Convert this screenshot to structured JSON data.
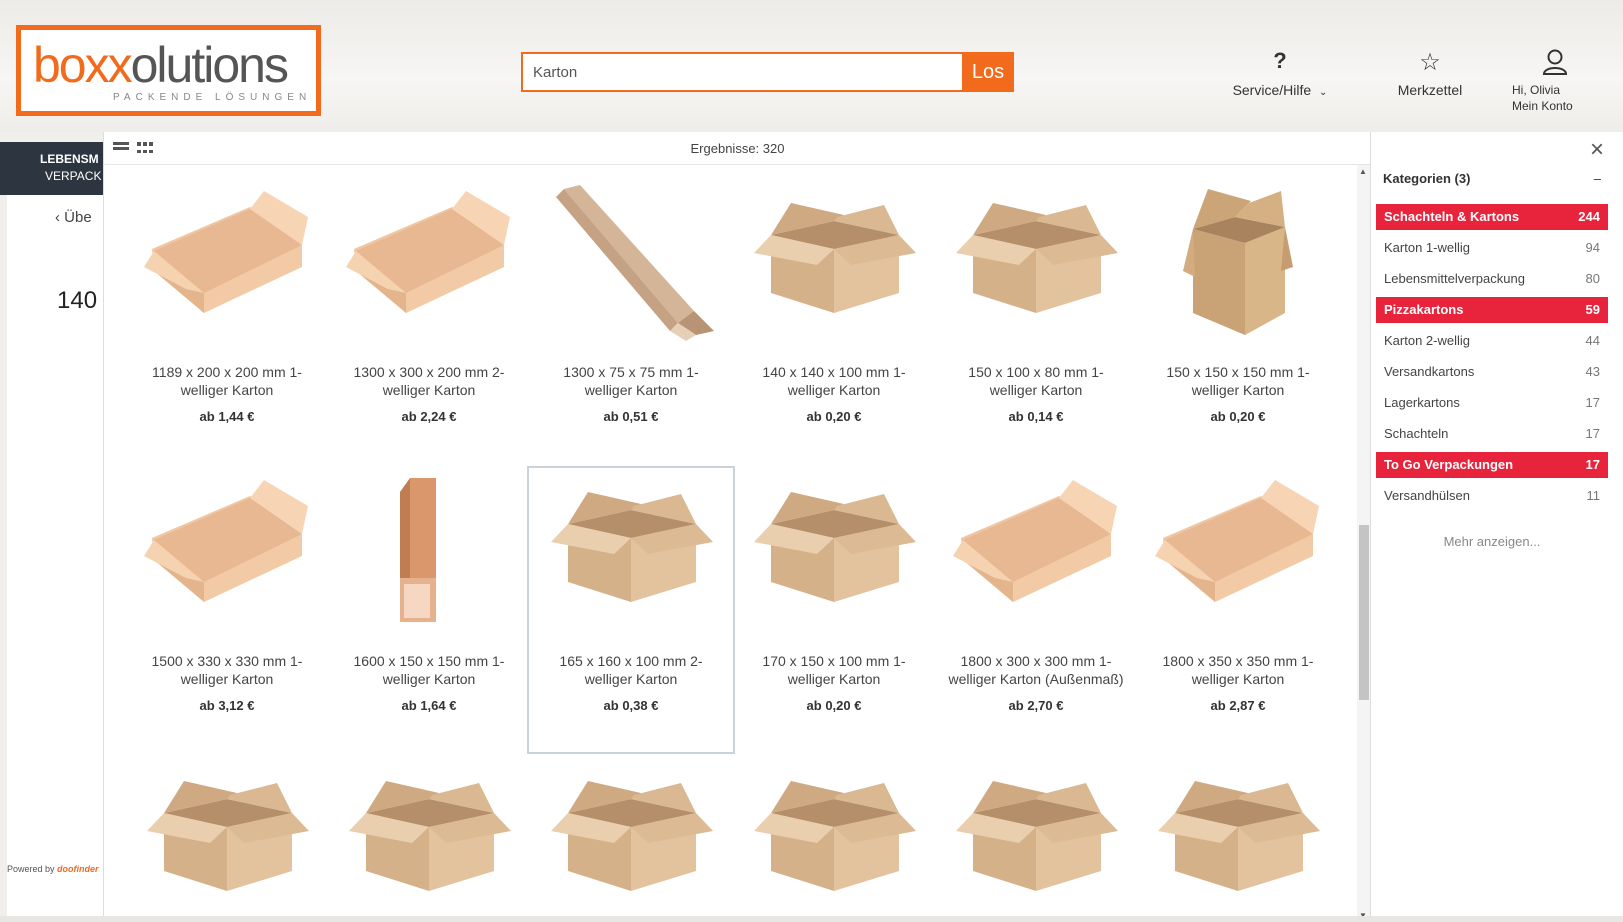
{
  "header": {
    "logo": {
      "part1": "box",
      "part2": "x",
      "part3": "olutions",
      "tagline": "PACKENDE LÖSUNGEN"
    },
    "search": {
      "value": "Karton",
      "button": "Los"
    },
    "service": {
      "icon": "?",
      "label": "Service/Hilfe"
    },
    "wishlist": {
      "icon": "☆",
      "label": "Merkzettel"
    },
    "account": {
      "line1": "Hi, Olivia",
      "line2": "Mein Konto"
    }
  },
  "background": {
    "nav_line1": "LEBENSM",
    "nav_line2": "VERPACK",
    "back_link": "Übe",
    "title": "140"
  },
  "results": {
    "count_label": "Ergebnisse: 320",
    "powered_by": "Powered by",
    "powered_brand": "doofinder",
    "items": [
      {
        "name": "1189 x 200 x 200 mm 1-welliger Karton",
        "price": "ab 1,44 €",
        "shape": "long"
      },
      {
        "name": "1300 x 300 x 200 mm 2-welliger Karton",
        "price": "ab 2,24 €",
        "shape": "long"
      },
      {
        "name": "1300 x 75 x 75 mm 1-welliger Karton",
        "price": "ab 0,51 €",
        "shape": "tube-diag"
      },
      {
        "name": "140 x 140 x 100 mm 1-welliger Karton",
        "price": "ab 0,20 €",
        "shape": "box"
      },
      {
        "name": "150 x 100 x 80 mm 1-welliger Karton",
        "price": "ab 0,14 €",
        "shape": "box"
      },
      {
        "name": "150 x 150 x 150 mm 1-welliger Karton",
        "price": "ab 0,20 €",
        "shape": "cube"
      },
      {
        "name": "1500 x 330 x 330 mm 1-welliger Karton",
        "price": "ab 3,12 €",
        "shape": "long"
      },
      {
        "name": "1600 x 150 x 150 mm 1-welliger Karton",
        "price": "ab 1,64 €",
        "shape": "tube-vert"
      },
      {
        "name": "165 x 160 x 100 mm 2-welliger Karton",
        "price": "ab 0,38 €",
        "shape": "box"
      },
      {
        "name": "170 x 150 x 100 mm 1-welliger Karton",
        "price": "ab 0,20 €",
        "shape": "box"
      },
      {
        "name": "1800 x 300 x 300 mm 1-welliger Karton (Außenmaß)",
        "price": "ab 2,70 €",
        "shape": "long"
      },
      {
        "name": "1800 x 350 x 350 mm 1-welliger Karton",
        "price": "ab 2,87 €",
        "shape": "long"
      },
      {
        "name": "",
        "price": "",
        "shape": "box"
      },
      {
        "name": "",
        "price": "",
        "shape": "box"
      },
      {
        "name": "",
        "price": "",
        "shape": "box"
      },
      {
        "name": "",
        "price": "",
        "shape": "box"
      },
      {
        "name": "",
        "price": "",
        "shape": "box"
      },
      {
        "name": "",
        "price": "",
        "shape": "box"
      }
    ],
    "selected_index": 8
  },
  "sidebar": {
    "close": "×",
    "heading": "Kategorien (3)",
    "collapse": "–",
    "categories": [
      {
        "label": "Schachteln & Kartons",
        "count": "244",
        "active": true
      },
      {
        "label": "Karton 1-wellig",
        "count": "94",
        "active": false
      },
      {
        "label": "Lebensmittelverpackung",
        "count": "80",
        "active": false
      },
      {
        "label": "Pizzakartons",
        "count": "59",
        "active": true
      },
      {
        "label": "Karton 2-wellig",
        "count": "44",
        "active": false
      },
      {
        "label": "Versandkartons",
        "count": "43",
        "active": false
      },
      {
        "label": "Lagerkartons",
        "count": "17",
        "active": false
      },
      {
        "label": "Schachteln",
        "count": "17",
        "active": false
      },
      {
        "label": "To Go Verpackungen",
        "count": "17",
        "active": true
      },
      {
        "label": "Versandhülsen",
        "count": "11",
        "active": false
      }
    ],
    "more": "Mehr anzeigen..."
  },
  "colors": {
    "brand": "#f26b1d",
    "active_filter": "#e8243c",
    "cardboard": "#d9b892"
  }
}
